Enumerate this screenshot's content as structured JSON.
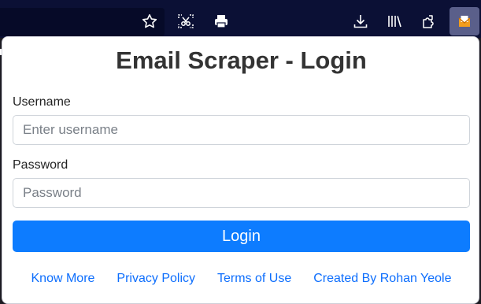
{
  "browser": {
    "toolbar_icons": [
      "star-icon",
      "screenshot-icon",
      "print-icon",
      "download-icon",
      "library-icon",
      "extensions-icon",
      "email-extension-icon"
    ]
  },
  "popup": {
    "title": "Email Scraper - Login",
    "username": {
      "label": "Username",
      "placeholder": "Enter username",
      "value": ""
    },
    "password": {
      "label": "Password",
      "placeholder": "Password",
      "value": ""
    },
    "login_button": "Login",
    "footer_links": [
      "Know More",
      "Privacy Policy",
      "Terms of Use",
      "Created By Rohan Yeole"
    ]
  },
  "colors": {
    "toolbar_bg": "#0b1035",
    "primary": "#0d7cff",
    "link": "#0d6efd",
    "title": "#333333"
  }
}
